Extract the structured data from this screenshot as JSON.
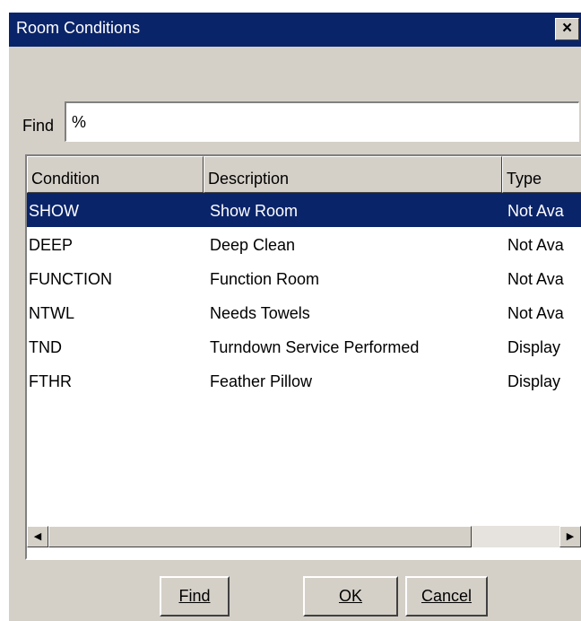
{
  "window": {
    "title": "Room Conditions",
    "close_label": "×"
  },
  "find": {
    "label": "Find",
    "value": "%"
  },
  "grid": {
    "columns": [
      "Condition",
      "Description",
      "Type"
    ],
    "rows": [
      {
        "condition": "SHOW",
        "description": "Show Room",
        "type": "Not Ava"
      },
      {
        "condition": "DEEP",
        "description": "Deep Clean",
        "type": "Not Ava"
      },
      {
        "condition": "FUNCTION",
        "description": "Function Room",
        "type": "Not Ava"
      },
      {
        "condition": "NTWL",
        "description": "Needs Towels",
        "type": "Not Ava"
      },
      {
        "condition": "TND",
        "description": "Turndown Service Performed",
        "type": "Display"
      },
      {
        "condition": "FTHR",
        "description": "Feather Pillow",
        "type": "Display"
      }
    ],
    "selected_row": 0
  },
  "buttons": {
    "find": "Find",
    "ok": "OK",
    "cancel": "Cancel"
  },
  "colors": {
    "titlebar": "#0a246a",
    "selection": "#0a246a",
    "face": "#d4d0c8"
  }
}
